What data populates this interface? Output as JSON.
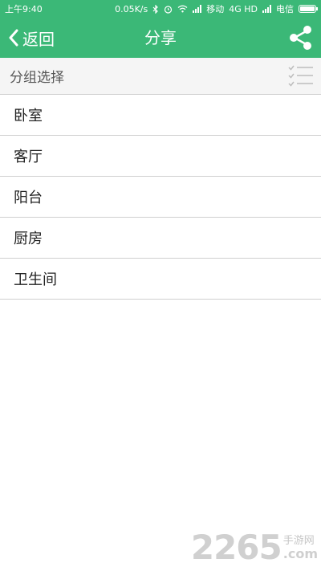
{
  "status_bar": {
    "time": "上午9:40",
    "net_speed": "0.05K/s",
    "carrier1": "移动",
    "network": "4G HD",
    "carrier2": "电信",
    "battery_level": 1.0
  },
  "appbar": {
    "back_label": "返回",
    "title": "分享",
    "share_icon": "share-icon"
  },
  "group": {
    "header": "分组选择",
    "select_icon": "checklist-icon"
  },
  "rooms": [
    "卧室",
    "客厅",
    "阳台",
    "厨房",
    "卫生间"
  ],
  "watermark": {
    "number": "2265",
    "chinese": "手游网",
    "suffix": ".com"
  },
  "colors": {
    "accent": "#3bb877",
    "divider": "#cfcfcf",
    "header_bg": "#f5f5f5"
  }
}
